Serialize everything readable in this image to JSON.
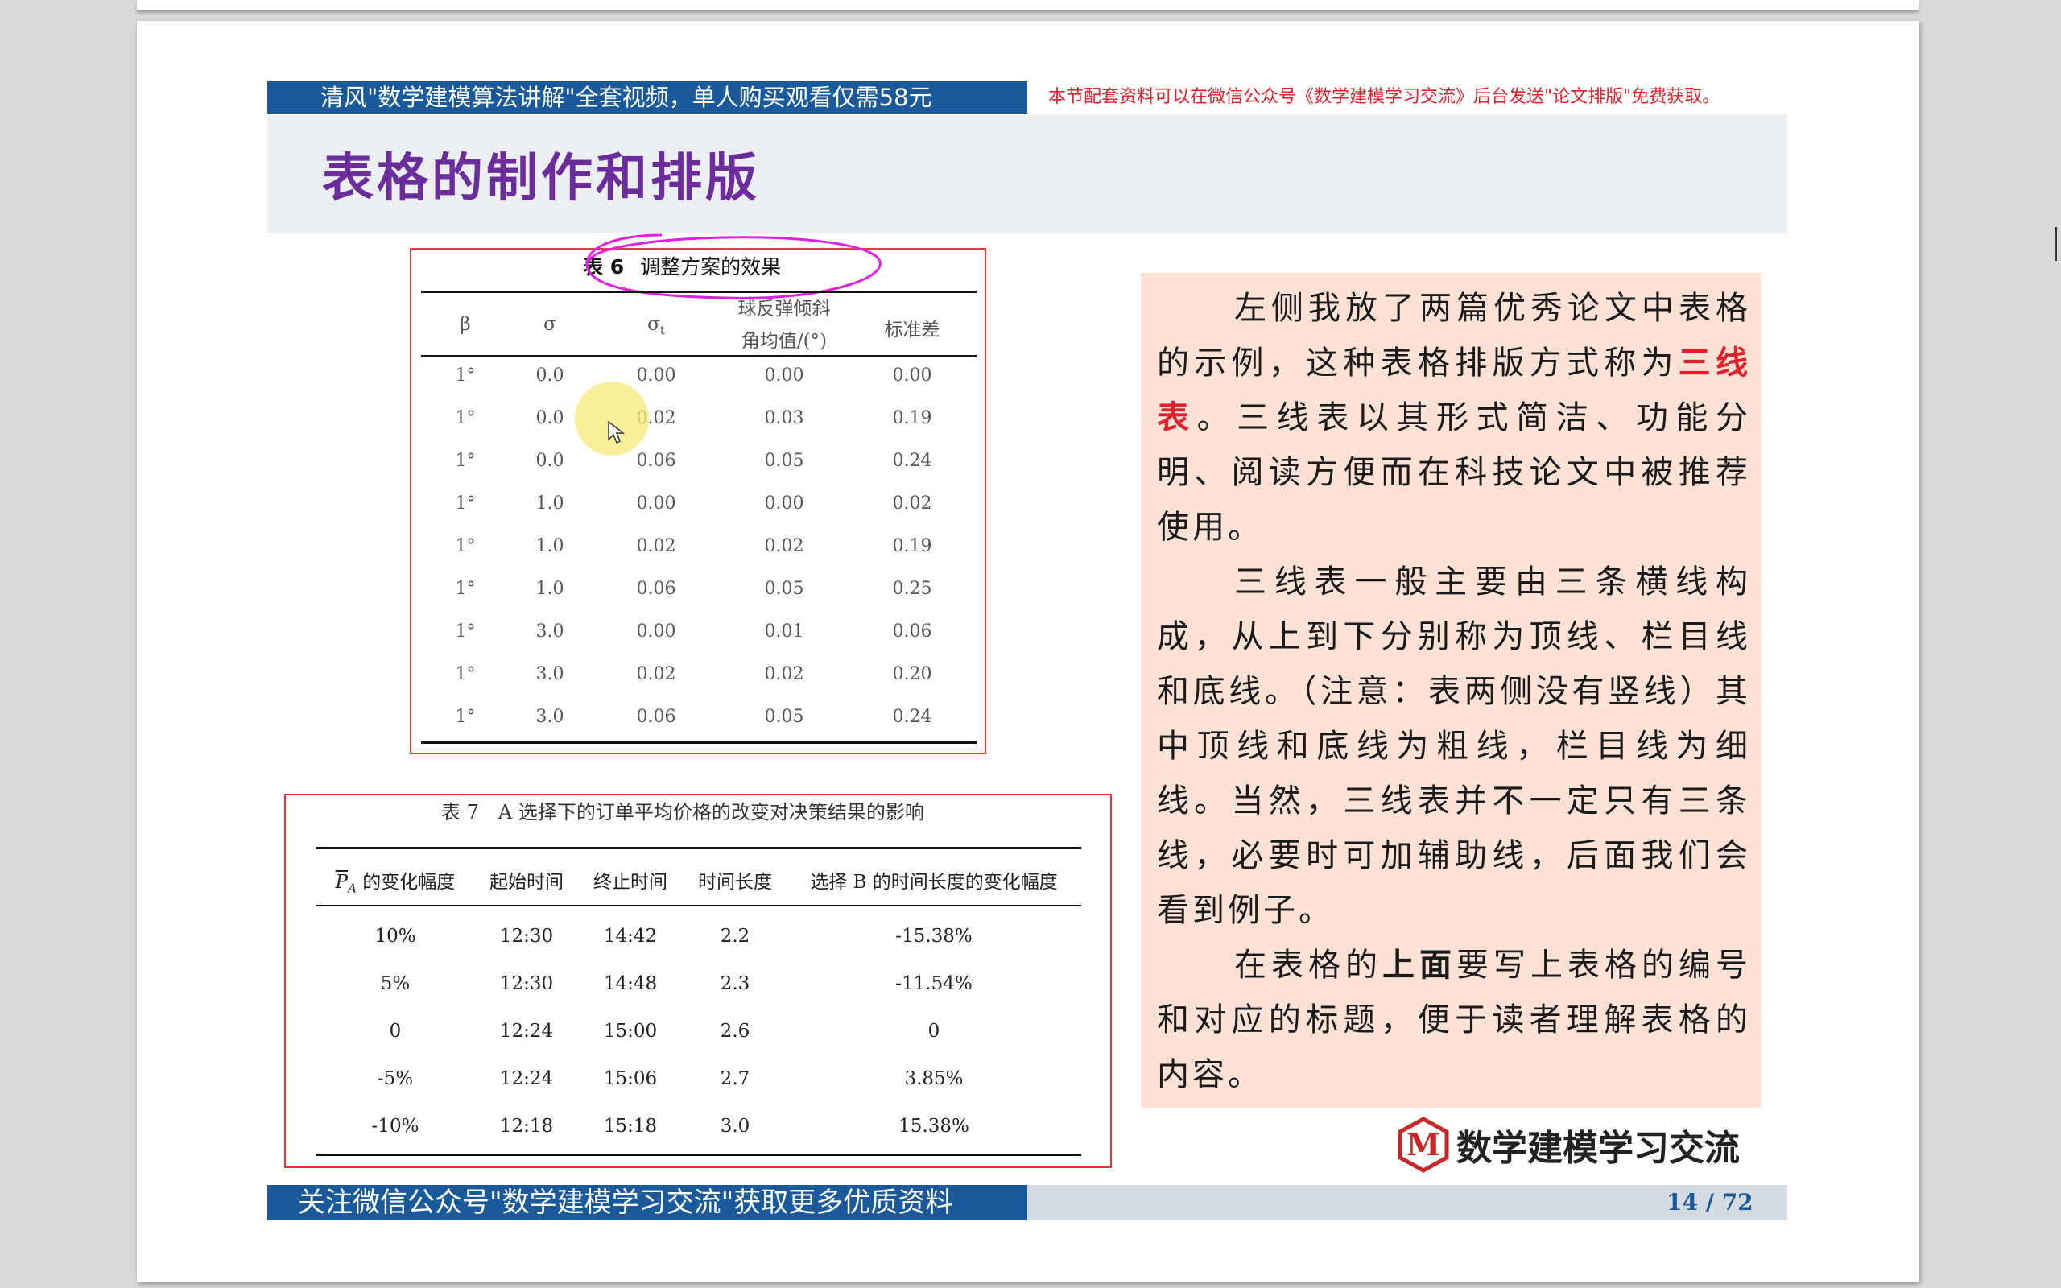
{
  "slide": {
    "top_banner": "清风\"数学建模算法讲解\"全套视频，单人购买观看仅需58元",
    "top_note": "本节配套资料可以在微信公众号《数学建模学习交流》后台发送\"论文排版\"免费获取。",
    "title": "表格的制作和排版",
    "bottom_banner": "关注微信公众号\"数学建模学习交流\"获取更多优质资料",
    "page": "14 / 72",
    "logo_letter": "M",
    "logo_text": "数学建模学习交流"
  },
  "table6": {
    "caption_num": "表 6",
    "caption_title": "调整方案的效果",
    "headers": [
      "β",
      "σ",
      "σ",
      "球反弹倾斜",
      "标准差"
    ],
    "header_sub": "t",
    "header_line2": "角均值/(°)",
    "rows": [
      [
        "1°",
        "0.0",
        "0.00",
        "0.00",
        "0.00"
      ],
      [
        "1°",
        "0.0",
        "0.02",
        "0.03",
        "0.19"
      ],
      [
        "1°",
        "0.0",
        "0.06",
        "0.05",
        "0.24"
      ],
      [
        "1°",
        "1.0",
        "0.00",
        "0.00",
        "0.02"
      ],
      [
        "1°",
        "1.0",
        "0.02",
        "0.02",
        "0.19"
      ],
      [
        "1°",
        "1.0",
        "0.06",
        "0.05",
        "0.25"
      ],
      [
        "1°",
        "3.0",
        "0.00",
        "0.01",
        "0.06"
      ],
      [
        "1°",
        "3.0",
        "0.02",
        "0.02",
        "0.20"
      ],
      [
        "1°",
        "3.0",
        "0.06",
        "0.05",
        "0.24"
      ]
    ]
  },
  "table7": {
    "caption": "表 7　A 选择下的订单平均价格的改变对决策结果的影响",
    "header_p": "P",
    "header_sub": "A",
    "headers": [
      "的变化幅度",
      "起始时间",
      "终止时间",
      "时间长度",
      "选择 B 的时间长度的变化幅度"
    ],
    "rows": [
      [
        "10%",
        "12:30",
        "14:42",
        "2.2",
        "-15.38%"
      ],
      [
        "5%",
        "12:30",
        "14:48",
        "2.3",
        "-11.54%"
      ],
      [
        "0",
        "12:24",
        "15:00",
        "2.6",
        "0"
      ],
      [
        "-5%",
        "12:24",
        "15:06",
        "2.7",
        "3.85%"
      ],
      [
        "-10%",
        "12:18",
        "15:18",
        "3.0",
        "15.38%"
      ]
    ]
  },
  "explanation": {
    "p1_before": "左侧我放了两篇优秀论文中表格的示例，这种表格排版方式称为",
    "p1_red": "三线表",
    "p1_after": "。三线表以其形式简洁、功能分明、阅读方便而在科技论文中被推荐使用。",
    "p2": "三线表一般主要由三条横线构成，从上到下分别称为顶线、栏目线和底线。（注意：表两侧没有竖线）其中顶线和底线为粗线，栏目线为细线。当然，三线表并不一定只有三条线，必要时可加辅助线，后面我们会看到例子。",
    "p3_before": "在表格的",
    "p3_bold": "上面",
    "p3_after": "要写上表格的编号和对应的标题，便于读者理解表格的内容。"
  },
  "colors": {
    "banner_blue": "#1a5a9b",
    "title_purple": "#6b2d9c",
    "note_red": "#e0202a",
    "text_bg": "#fde2d5",
    "annotation_magenta": "#e020e0"
  }
}
